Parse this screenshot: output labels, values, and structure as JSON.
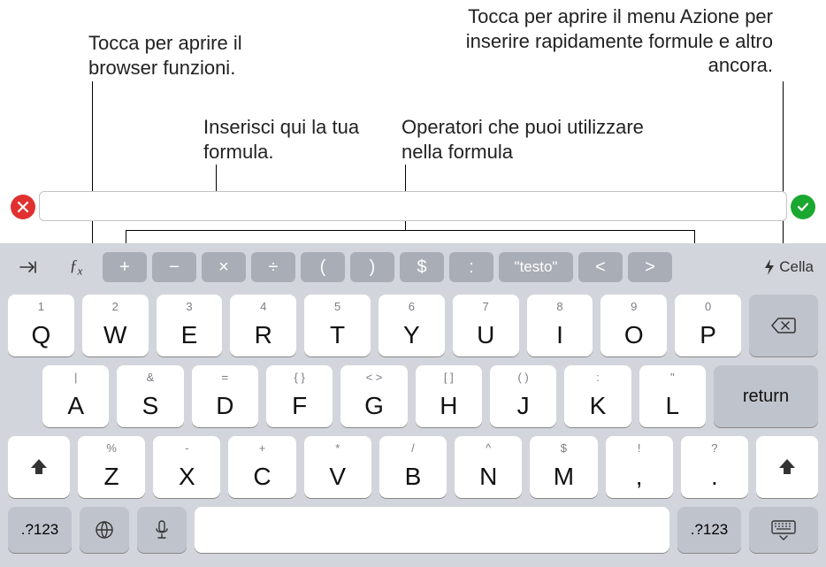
{
  "callouts": {
    "fx": "Tocca per aprire il browser funzioni.",
    "formula": "Inserisci qui la tua formula.",
    "ops": "Operatori che puoi utilizzare nella formula",
    "cella": "Tocca per aprire il menu Azione per inserire rapidamente formule e altro ancora."
  },
  "fnrow": {
    "fx_label": "ƒx",
    "ops": [
      "+",
      "−",
      "×",
      "÷",
      "(",
      ")",
      "$",
      ":"
    ],
    "text_op": "\"testo\"",
    "lt": "<",
    "gt": ">",
    "cell_label": "Cella"
  },
  "rows": {
    "r1": [
      {
        "sub": "1",
        "main": "Q"
      },
      {
        "sub": "2",
        "main": "W"
      },
      {
        "sub": "3",
        "main": "E"
      },
      {
        "sub": "4",
        "main": "R"
      },
      {
        "sub": "5",
        "main": "T"
      },
      {
        "sub": "6",
        "main": "Y"
      },
      {
        "sub": "7",
        "main": "U"
      },
      {
        "sub": "8",
        "main": "I"
      },
      {
        "sub": "9",
        "main": "O"
      },
      {
        "sub": "0",
        "main": "P"
      }
    ],
    "r2": [
      {
        "sub": "|",
        "main": "A"
      },
      {
        "sub": "&",
        "main": "S"
      },
      {
        "sub": "=",
        "main": "D"
      },
      {
        "sub": "{   }",
        "main": "F"
      },
      {
        "sub": "<   >",
        "main": "G"
      },
      {
        "sub": "[   ]",
        "main": "H"
      },
      {
        "sub": "(   )",
        "main": "J"
      },
      {
        "sub": ":",
        "main": "K"
      },
      {
        "sub": "\"",
        "main": "L"
      }
    ],
    "r3": [
      {
        "sub": "%",
        "main": "Z"
      },
      {
        "sub": "-",
        "main": "X"
      },
      {
        "sub": "+",
        "main": "C"
      },
      {
        "sub": "*",
        "main": "V"
      },
      {
        "sub": "/",
        "main": "B"
      },
      {
        "sub": "^",
        "main": "N"
      },
      {
        "sub": "$",
        "main": "M"
      },
      {
        "sub": "!",
        "main": ","
      },
      {
        "sub": "?",
        "main": "."
      }
    ]
  },
  "special": {
    "return": "return",
    "mode": ".?123"
  }
}
